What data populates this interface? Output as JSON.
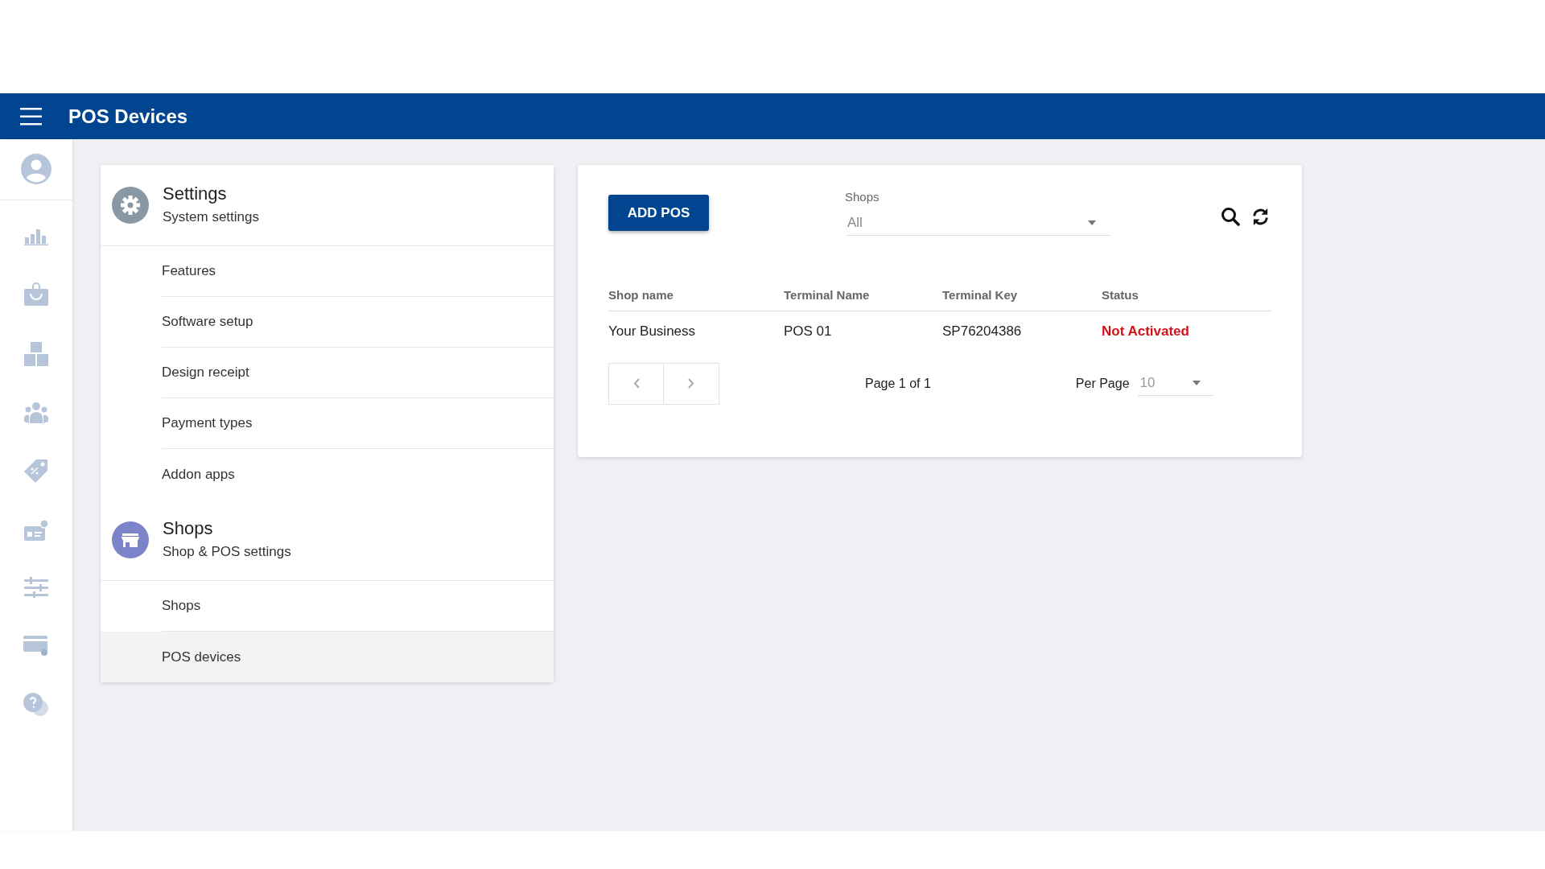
{
  "app_bar": {
    "title": "POS Devices"
  },
  "settings_menu": {
    "groups": [
      {
        "title": "Settings",
        "subtitle": "System settings",
        "color": "#8a98a5",
        "items": [
          {
            "label": "Features",
            "selected": false
          },
          {
            "label": "Software setup",
            "selected": false
          },
          {
            "label": "Design receipt",
            "selected": false
          },
          {
            "label": "Payment types",
            "selected": false
          },
          {
            "label": "Addon apps",
            "selected": false
          }
        ]
      },
      {
        "title": "Shops",
        "subtitle": "Shop & POS settings",
        "color": "#7b84c8",
        "items": [
          {
            "label": "Shops",
            "selected": false
          },
          {
            "label": "POS devices",
            "selected": true
          }
        ]
      }
    ]
  },
  "pos_card": {
    "add_button": "ADD POS",
    "shop_filter": {
      "label": "Shops",
      "value": "All"
    },
    "table": {
      "columns": [
        "Shop name",
        "Terminal Name",
        "Terminal Key",
        "Status"
      ],
      "rows": [
        {
          "cells": [
            "Your Business",
            "POS 01",
            "SP76204386",
            "Not Activated"
          ]
        }
      ]
    },
    "pagination": {
      "page_text": "Page 1 of 1",
      "per_page_label": "Per Page",
      "per_page_value": "10"
    }
  }
}
